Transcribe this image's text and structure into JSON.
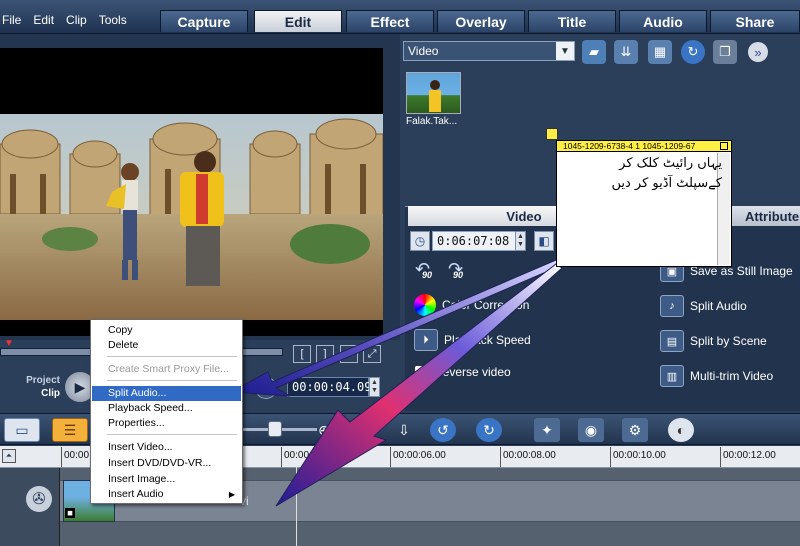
{
  "menu": [
    "File",
    "Edit",
    "Clip",
    "Tools"
  ],
  "steps": [
    "Capture",
    "Edit",
    "Effect",
    "Overlay",
    "Title",
    "Audio",
    "Share"
  ],
  "library": {
    "selected": "Video",
    "thumb_label": "Falak.Tak..."
  },
  "options": {
    "tab_video": "Video",
    "tab_attribute": "Attribute",
    "duration": "0:06:07:08",
    "items_left": [
      "Color Correction",
      "Playback Speed",
      "Reverse video"
    ],
    "items_right": [
      "Save as Still Image",
      "Split Audio",
      "Split by Scene",
      "Multi-trim Video"
    ]
  },
  "player": {
    "project_label": "Project",
    "clip_label": "Clip",
    "timecode": "00:00:04.09"
  },
  "ruler": [
    "00:00",
    "00:00:04.00",
    "00:00:06.00",
    "00:00:08.00",
    "00:00:10.00",
    "00:00:12.00"
  ],
  "track": {
    "clip_name": "vi"
  },
  "context_menu": {
    "items": [
      "Copy",
      "Delete",
      "Create Smart Proxy File...",
      "Split Audio...",
      "Playback Speed...",
      "Properties...",
      "Insert Video...",
      "Insert DVD/DVD-VR...",
      "Insert Image...",
      "Insert Audio"
    ]
  },
  "note": {
    "header": "1045-1209-6738-4 1 1045-1209-67",
    "line1": "یہاں رائیٹ کلک کر",
    "line2": "کےسپلٹ آڈیو کر دیں"
  },
  "colors": {
    "accent": "#316ac5",
    "sticky": "#ffee44"
  }
}
